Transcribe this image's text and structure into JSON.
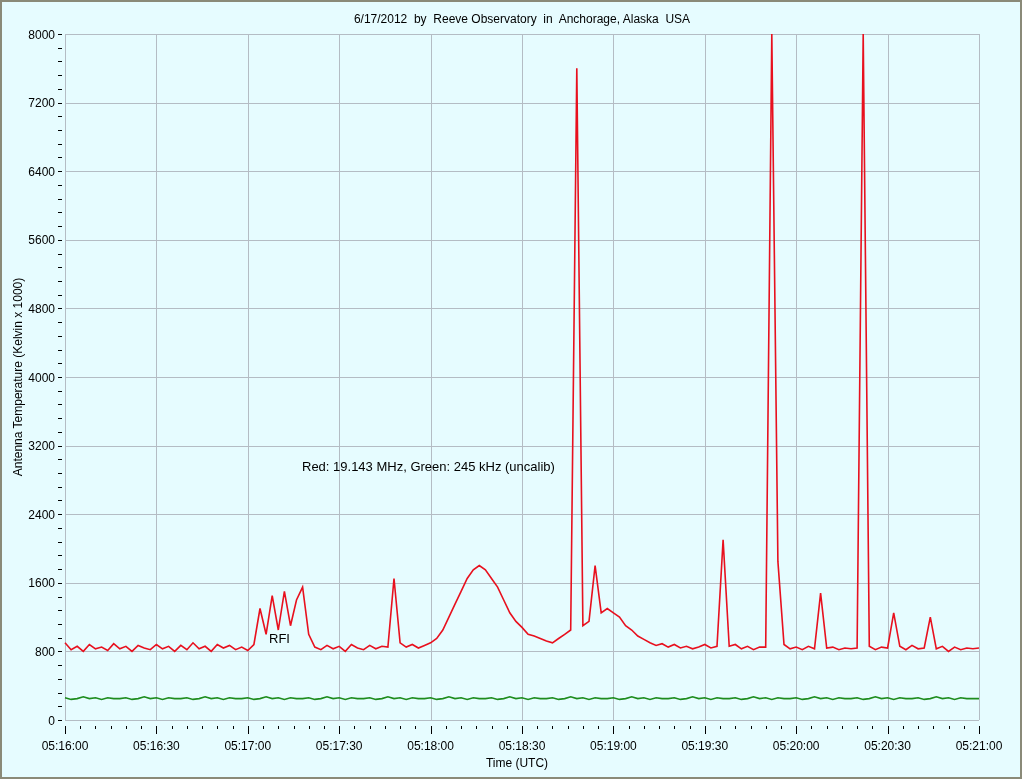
{
  "chart_data": {
    "type": "line",
    "title": "6/17/2012  by  Reeve Observatory  in  Anchorage, Alaska  USA",
    "xlabel": "Time (UTC)",
    "ylabel": "Antenna Temperature (Kelvin x 1000)",
    "categories": [
      "05:16:00",
      null,
      null,
      null,
      null,
      null,
      null,
      null,
      null,
      null,
      null,
      null,
      null,
      null,
      null,
      "05:16:30",
      null,
      null,
      null,
      null,
      null,
      null,
      null,
      null,
      null,
      null,
      null,
      null,
      null,
      null,
      "05:17:00",
      null,
      null,
      null,
      null,
      null,
      null,
      null,
      null,
      null,
      null,
      null,
      null,
      null,
      null,
      "05:17:30",
      null,
      null,
      null,
      null,
      null,
      null,
      null,
      null,
      null,
      null,
      null,
      null,
      null,
      null,
      "05:18:00",
      null,
      null,
      null,
      null,
      null,
      null,
      null,
      null,
      null,
      null,
      null,
      null,
      null,
      null,
      "05:18:30",
      null,
      null,
      null,
      null,
      null,
      null,
      null,
      null,
      null,
      null,
      null,
      null,
      null,
      null,
      "05:19:00",
      null,
      null,
      null,
      null,
      null,
      null,
      null,
      null,
      null,
      null,
      null,
      null,
      null,
      null,
      "05:19:30",
      null,
      null,
      null,
      null,
      null,
      null,
      null,
      null,
      null,
      null,
      null,
      null,
      null,
      null,
      "05:20:00",
      null,
      null,
      null,
      null,
      null,
      null,
      null,
      null,
      null,
      null,
      null,
      null,
      null,
      null,
      "05:20:30",
      null,
      null,
      null,
      null,
      null,
      null,
      null,
      null,
      null,
      null,
      null,
      null,
      null,
      null,
      "05:21:00"
    ],
    "series": [
      {
        "color": "#e8101e",
        "values": [
          900,
          820,
          860,
          800,
          880,
          830,
          850,
          810,
          890,
          830,
          860,
          800,
          870,
          840,
          820,
          880,
          830,
          860,
          800,
          870,
          820,
          900,
          830,
          860,
          800,
          880,
          840,
          870,
          820,
          850,
          810,
          880,
          1300,
          1000,
          1450,
          1050,
          1500,
          1100,
          1400,
          1550,
          1000,
          850,
          820,
          870,
          830,
          860,
          800,
          880,
          840,
          820,
          870,
          830,
          860,
          850,
          1650,
          900,
          850,
          880,
          840,
          870,
          900,
          950,
          1050,
          1200,
          1350,
          1500,
          1650,
          1750,
          1800,
          1750,
          1650,
          1550,
          1400,
          1250,
          1150,
          1080,
          1000,
          980,
          950,
          920,
          900,
          950,
          1000,
          1050,
          7600,
          1100,
          1150,
          1800,
          1250,
          1300,
          1250,
          1200,
          1100,
          1050,
          980,
          940,
          900,
          870,
          890,
          850,
          880,
          840,
          860,
          830,
          850,
          880,
          840,
          860,
          2100,
          860,
          880,
          830,
          860,
          820,
          850,
          850,
          8000,
          1850,
          880,
          830,
          850,
          820,
          860,
          830,
          1480,
          840,
          850,
          820,
          840,
          830,
          840,
          8000,
          860,
          820,
          850,
          840,
          1250,
          860,
          820,
          870,
          830,
          840,
          1200,
          830,
          860,
          800,
          850,
          820,
          840,
          830,
          840
        ]
      },
      {
        "color": "#1e8c1e",
        "values": [
          260,
          240,
          250,
          270,
          250,
          260,
          240,
          260,
          250,
          250,
          260,
          240,
          250,
          270,
          250,
          260,
          240,
          260,
          250,
          250,
          260,
          240,
          250,
          270,
          250,
          260,
          240,
          260,
          250,
          250,
          260,
          240,
          250,
          270,
          250,
          260,
          240,
          260,
          250,
          250,
          260,
          240,
          250,
          270,
          250,
          260,
          240,
          260,
          250,
          250,
          260,
          240,
          250,
          270,
          250,
          260,
          240,
          260,
          250,
          250,
          260,
          240,
          250,
          270,
          250,
          260,
          240,
          260,
          250,
          250,
          260,
          240,
          250,
          270,
          250,
          260,
          240,
          260,
          250,
          250,
          260,
          240,
          250,
          270,
          250,
          260,
          240,
          260,
          250,
          250,
          260,
          240,
          250,
          270,
          250,
          260,
          240,
          260,
          250,
          250,
          260,
          240,
          250,
          270,
          250,
          260,
          240,
          260,
          250,
          250,
          260,
          240,
          250,
          270,
          250,
          260,
          240,
          260,
          250,
          250,
          260,
          240,
          250,
          270,
          250,
          260,
          240,
          260,
          250,
          250,
          260,
          240,
          250,
          270,
          250,
          260,
          240,
          260,
          250,
          250,
          260,
          240,
          250,
          270,
          250,
          260,
          240,
          260,
          250,
          250,
          250
        ]
      }
    ],
    "ylim": [
      0,
      8000
    ],
    "grid": true,
    "yticks": [
      0,
      800,
      1600,
      2400,
      3200,
      4000,
      4800,
      5600,
      6400,
      7200,
      8000
    ],
    "annotations": [
      "Red: 19.143 MHz, Green: 245 kHz (uncalib)",
      "RFI"
    ]
  }
}
